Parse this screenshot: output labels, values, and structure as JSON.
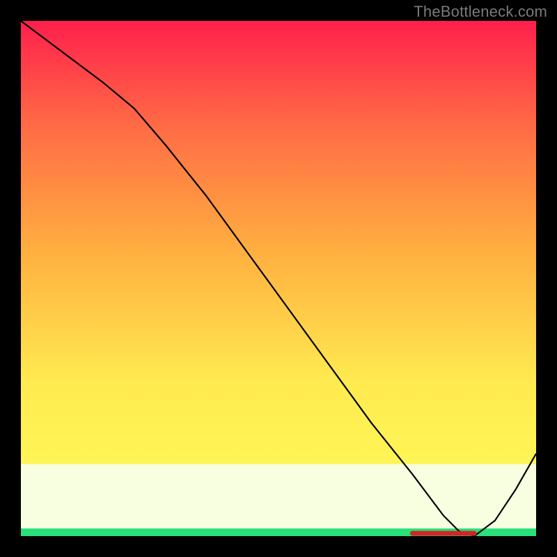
{
  "watermark": "TheBottleneck.com",
  "chart_data": {
    "type": "line",
    "title": "",
    "xlabel": "",
    "ylabel": "",
    "xlim": [
      0,
      100
    ],
    "ylim": [
      0,
      100
    ],
    "series": [
      {
        "name": "bottleneck-curve",
        "x": [
          0,
          8,
          16,
          22,
          28,
          36,
          44,
          52,
          60,
          68,
          76,
          82,
          85,
          88,
          92,
          96,
          100
        ],
        "y": [
          100,
          94,
          88,
          83,
          76,
          66,
          55,
          44,
          33,
          22,
          12,
          4,
          1,
          0,
          3,
          9,
          16
        ]
      }
    ],
    "annotations": [
      {
        "name": "optimum-band",
        "x_start": 76,
        "x_end": 88,
        "y": 0
      }
    ],
    "gradient_stops_top_to_bottom": [
      "#ff1f4c",
      "#ff6a45",
      "#ffb040",
      "#ffea50",
      "#ffff5a",
      "#f8ffe0",
      "#29e07a"
    ]
  }
}
